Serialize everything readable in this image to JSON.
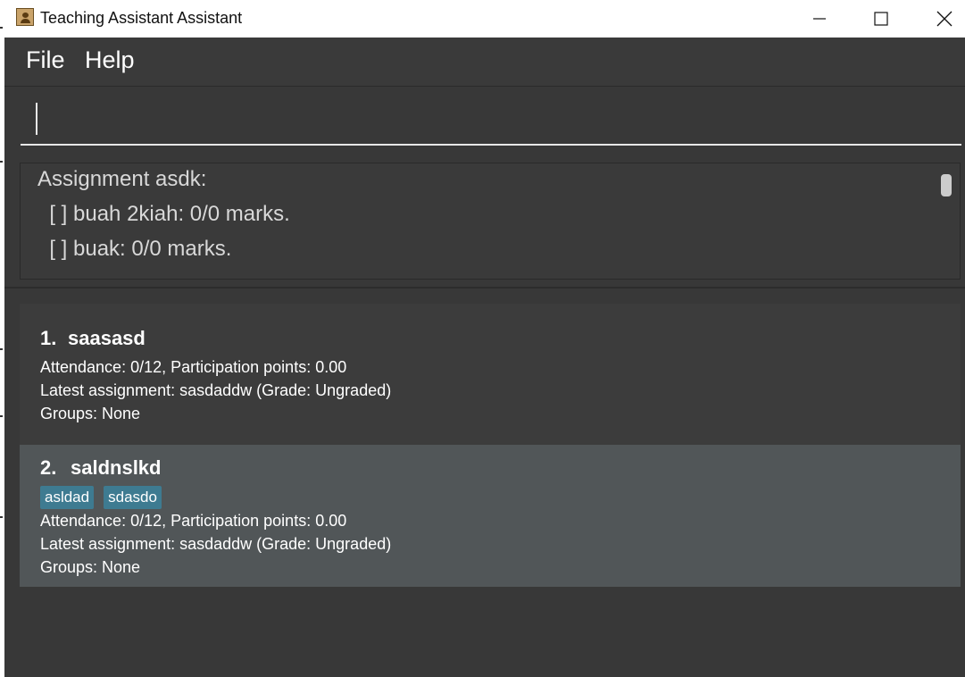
{
  "window": {
    "title": "Teaching Assistant Assistant"
  },
  "menu": {
    "items": [
      {
        "label": "File"
      },
      {
        "label": "Help"
      }
    ]
  },
  "command_box": {
    "value": ""
  },
  "result_display": {
    "lines": [
      "Assignment asdk:",
      "  [ ] buah 2kiah: 0/0 marks.",
      "  [ ] buak: 0/0 marks."
    ]
  },
  "students": [
    {
      "index": "1.",
      "name": "saasasd",
      "tags": [],
      "attendance": "Attendance: 0/12, Participation points: 0.00",
      "assignment": "Latest assignment: sasdaddw (Grade: Ungraded)",
      "groups": "Groups: None"
    },
    {
      "index": "2.",
      "name": "saldnslkd",
      "tags": [
        "asldad",
        "sdasdo"
      ],
      "attendance": "Attendance: 0/12, Participation points: 0.00",
      "assignment": "Latest assignment: sasdaddw (Grade: Ungraded)",
      "groups": "Groups: None"
    }
  ],
  "colors": {
    "background": "#383838",
    "selected_card": "#515658",
    "tag": "#3e7b91"
  }
}
